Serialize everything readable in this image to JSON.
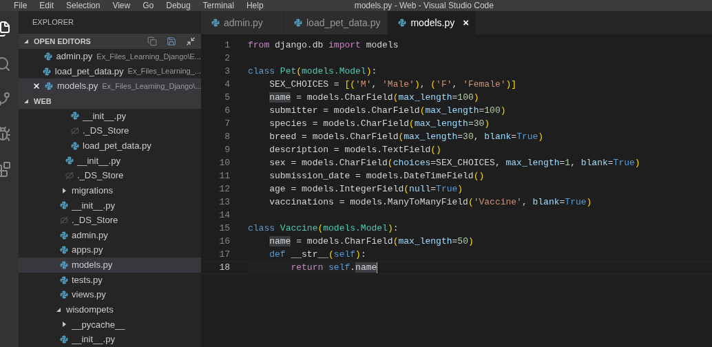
{
  "menu_bar": {
    "items": [
      "File",
      "Edit",
      "Selection",
      "View",
      "Go",
      "Debug",
      "Terminal",
      "Help"
    ],
    "title": "models.py - Web - Visual Studio Code"
  },
  "sidebar": {
    "title": "EXPLORER",
    "open_editors": {
      "title": "OPEN EDITORS",
      "expanded": true,
      "items": [
        {
          "name": "admin.py",
          "path": "Ex_Files_Learning_Django\\E...",
          "selected": false
        },
        {
          "name": "load_pet_data.py",
          "path": "Ex_Files_Learning_...",
          "selected": false
        },
        {
          "name": "models.py",
          "path": "Ex_Files_Learning_Django\\...",
          "selected": true
        }
      ]
    },
    "folder": {
      "title": "WEB",
      "expanded": true,
      "tree": [
        {
          "children": [
            {
              "children": [
                {
                  "children": [
                    {
                      "kind": "python",
                      "label": "__init__.py",
                      "selected": false
                    },
                    {
                      "kind": "other",
                      "label": "._DS_Store",
                      "selected": false
                    },
                    {
                      "kind": "python",
                      "label": "load_pet_data.py",
                      "selected": false
                    }
                  ]
                },
                {
                  "kind": "python",
                  "label": "__init__.py",
                  "selected": false
                },
                {
                  "kind": "other",
                  "label": "._DS_Store",
                  "selected": false
                }
              ]
            },
            {
              "kind": "folder",
              "label": "migrations",
              "expanded": false,
              "selected": false
            },
            {
              "kind": "python",
              "label": "__init__.py",
              "selected": false
            },
            {
              "kind": "other",
              "label": "._DS_Store",
              "selected": false
            },
            {
              "kind": "python",
              "label": "admin.py",
              "selected": false
            },
            {
              "kind": "python",
              "label": "apps.py",
              "selected": false
            },
            {
              "kind": "python",
              "label": "models.py",
              "selected": true
            },
            {
              "kind": "python",
              "label": "tests.py",
              "selected": false
            },
            {
              "kind": "python",
              "label": "views.py",
              "selected": false
            }
          ]
        },
        {
          "kind": "folder",
          "label": "wisdompets",
          "expanded": true,
          "selected": false,
          "children": [
            {
              "kind": "folder",
              "label": "__pycache__",
              "expanded": false,
              "selected": false
            },
            {
              "kind": "python",
              "label": "__init__.py",
              "selected": false
            }
          ]
        }
      ]
    }
  },
  "tabs": [
    {
      "label": "admin.py",
      "selected": false
    },
    {
      "label": "load_pet_data.py",
      "selected": false
    },
    {
      "label": "models.py",
      "selected": true,
      "close": "×"
    }
  ],
  "editor": {
    "lines": [
      {
        "number": "1",
        "current": false,
        "tokens": [
          {
            "kind": "kw",
            "text": "from"
          },
          {
            "kind": "plain",
            "text": " django.db "
          },
          {
            "kind": "kw",
            "text": "import"
          },
          {
            "kind": "plain",
            "text": " models"
          }
        ]
      },
      {
        "number": "2",
        "current": false
      },
      {
        "number": "3",
        "current": false,
        "tokens": [
          {
            "kind": "storage",
            "text": "class"
          },
          {
            "kind": "type",
            "text": " Pet"
          },
          {
            "kind": "paren",
            "text": "("
          },
          {
            "kind": "type",
            "text": "models.Model"
          },
          {
            "kind": "paren",
            "text": ")"
          },
          {
            "kind": "plain",
            "text": ":"
          }
        ]
      },
      {
        "number": "4",
        "current": false,
        "tokens": [
          {
            "kind": "plain",
            "text": "    SEX_CHOICES = "
          },
          {
            "kind": "paren",
            "text": "[("
          },
          {
            "kind": "str",
            "text": "'M'"
          },
          {
            "kind": "plain",
            "text": ", "
          },
          {
            "kind": "str",
            "text": "'Male'"
          },
          {
            "kind": "paren",
            "text": ")"
          },
          {
            "kind": "plain",
            "text": ", "
          },
          {
            "kind": "paren",
            "text": "("
          },
          {
            "kind": "str",
            "text": "'F'"
          },
          {
            "kind": "plain",
            "text": ", "
          },
          {
            "kind": "str",
            "text": "'Female'"
          },
          {
            "kind": "paren",
            "text": ")]"
          }
        ]
      },
      {
        "number": "5",
        "current": false,
        "tokens": [
          {
            "kind": "hl",
            "text": "    name"
          },
          {
            "kind": "plain",
            "text": " = models.CharField"
          },
          {
            "kind": "paren",
            "text": "("
          },
          {
            "kind": "param",
            "text": "max_length"
          },
          {
            "kind": "plain",
            "text": "="
          },
          {
            "kind": "num",
            "text": "100"
          },
          {
            "kind": "paren",
            "text": ")"
          }
        ]
      },
      {
        "number": "6",
        "current": false,
        "tokens": [
          {
            "kind": "plain",
            "text": "    submitter = models.CharField"
          },
          {
            "kind": "paren",
            "text": "("
          },
          {
            "kind": "param",
            "text": "max_length"
          },
          {
            "kind": "plain",
            "text": "="
          },
          {
            "kind": "num",
            "text": "100"
          },
          {
            "kind": "paren",
            "text": ")"
          }
        ]
      },
      {
        "number": "7",
        "current": false,
        "tokens": [
          {
            "kind": "plain",
            "text": "    species = models.CharField"
          },
          {
            "kind": "paren",
            "text": "("
          },
          {
            "kind": "param",
            "text": "max_length"
          },
          {
            "kind": "plain",
            "text": "="
          },
          {
            "kind": "num",
            "text": "30"
          },
          {
            "kind": "paren",
            "text": ")"
          }
        ]
      },
      {
        "number": "8",
        "current": false,
        "tokens": [
          {
            "kind": "plain",
            "text": "    breed = models.CharField"
          },
          {
            "kind": "paren",
            "text": "("
          },
          {
            "kind": "param",
            "text": "max_length"
          },
          {
            "kind": "plain",
            "text": "="
          },
          {
            "kind": "num",
            "text": "30"
          },
          {
            "kind": "plain",
            "text": ", "
          },
          {
            "kind": "param",
            "text": "blank"
          },
          {
            "kind": "plain",
            "text": "="
          },
          {
            "kind": "storage",
            "text": "True"
          },
          {
            "kind": "paren",
            "text": ")"
          }
        ]
      },
      {
        "number": "9",
        "current": false,
        "tokens": [
          {
            "kind": "plain",
            "text": "    description = models.TextField"
          },
          {
            "kind": "paren",
            "text": "()"
          }
        ]
      },
      {
        "number": "10",
        "current": false,
        "tokens": [
          {
            "kind": "plain",
            "text": "    sex = models.CharField"
          },
          {
            "kind": "paren",
            "text": "("
          },
          {
            "kind": "param",
            "text": "choices"
          },
          {
            "kind": "plain",
            "text": "=SEX_CHOICES, "
          },
          {
            "kind": "param",
            "text": "max_length"
          },
          {
            "kind": "plain",
            "text": "="
          },
          {
            "kind": "num",
            "text": "1"
          },
          {
            "kind": "plain",
            "text": ", "
          },
          {
            "kind": "param",
            "text": "blank"
          },
          {
            "kind": "plain",
            "text": "="
          },
          {
            "kind": "storage",
            "text": "True"
          },
          {
            "kind": "paren",
            "text": ")"
          }
        ]
      },
      {
        "number": "11",
        "current": false,
        "tokens": [
          {
            "kind": "plain",
            "text": "    submission_date = models.DateTimeField"
          },
          {
            "kind": "paren",
            "text": "()"
          }
        ]
      },
      {
        "number": "12",
        "current": false,
        "tokens": [
          {
            "kind": "plain",
            "text": "    age = models.IntegerField"
          },
          {
            "kind": "paren",
            "text": "("
          },
          {
            "kind": "param",
            "text": "null"
          },
          {
            "kind": "plain",
            "text": "="
          },
          {
            "kind": "storage",
            "text": "True"
          },
          {
            "kind": "paren",
            "text": ")"
          }
        ]
      },
      {
        "number": "13",
        "current": false,
        "tokens": [
          {
            "kind": "plain",
            "text": "    vaccinations = models.ManyToManyField"
          },
          {
            "kind": "paren",
            "text": "("
          },
          {
            "kind": "str",
            "text": "'Vaccine'"
          },
          {
            "kind": "plain",
            "text": ", "
          },
          {
            "kind": "param",
            "text": "blank"
          },
          {
            "kind": "plain",
            "text": "="
          },
          {
            "kind": "storage",
            "text": "True"
          },
          {
            "kind": "paren",
            "text": ")"
          }
        ]
      },
      {
        "number": "14",
        "current": false
      },
      {
        "number": "15",
        "current": false,
        "tokens": [
          {
            "kind": "storage",
            "text": "class"
          },
          {
            "kind": "type",
            "text": " Vaccine"
          },
          {
            "kind": "paren",
            "text": "("
          },
          {
            "kind": "type",
            "text": "models.Model"
          },
          {
            "kind": "paren",
            "text": ")"
          },
          {
            "kind": "plain",
            "text": ":"
          }
        ]
      },
      {
        "number": "16",
        "current": false,
        "tokens": [
          {
            "kind": "hl",
            "text": "    name"
          },
          {
            "kind": "plain",
            "text": " = models.CharField"
          },
          {
            "kind": "paren",
            "text": "("
          },
          {
            "kind": "param",
            "text": "max_length"
          },
          {
            "kind": "plain",
            "text": "="
          },
          {
            "kind": "num",
            "text": "50"
          },
          {
            "kind": "paren",
            "text": ")"
          }
        ]
      },
      {
        "number": "17",
        "current": false,
        "tokens": [
          {
            "kind": "storage",
            "text": "    def"
          },
          {
            "kind": "plain",
            "text": " __str__"
          },
          {
            "kind": "paren",
            "text": "("
          },
          {
            "kind": "storage",
            "text": "self"
          },
          {
            "kind": "paren",
            "text": ")"
          },
          {
            "kind": "plain",
            "text": ":"
          }
        ]
      },
      {
        "number": "18",
        "current": true,
        "tokens": [
          {
            "kind": "kw",
            "text": "        return"
          },
          {
            "kind": "storage",
            "text": " self"
          },
          {
            "kind": "plain",
            "text": "."
          },
          {
            "kind": "hl",
            "text": "name"
          }
        ]
      }
    ]
  }
}
